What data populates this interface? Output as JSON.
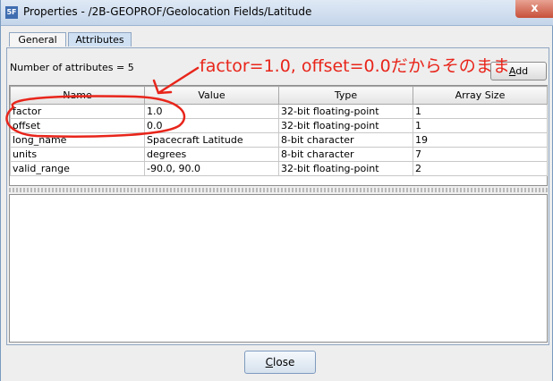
{
  "window": {
    "title": "Properties - /2B-GEOPROF/Geolocation Fields/Latitude",
    "app_icon_text": "5F",
    "close_glyph": "x"
  },
  "tabs": [
    {
      "label": "General"
    },
    {
      "label": "Attributes",
      "selected": true
    }
  ],
  "attributes": {
    "count_text": "Number of attributes = 5",
    "add_label": "Add",
    "columns": [
      "Name",
      "Value",
      "Type",
      "Array Size"
    ],
    "rows": [
      {
        "name": "factor",
        "value": "1.0",
        "type": "32-bit floating-point",
        "size": "1"
      },
      {
        "name": "offset",
        "value": "0.0",
        "type": "32-bit floating-point",
        "size": "1"
      },
      {
        "name": "long_name",
        "value": "Spacecraft Latitude",
        "type": "8-bit character",
        "size": "19"
      },
      {
        "name": "units",
        "value": "degrees",
        "type": "8-bit character",
        "size": "7"
      },
      {
        "name": "valid_range",
        "value": "-90.0, 90.0",
        "type": "32-bit floating-point",
        "size": "2"
      }
    ]
  },
  "annotation": {
    "text": "factor=1.0, offset=0.0だからそのまま",
    "color": "#e8251b"
  },
  "footer": {
    "close_label": "Close"
  },
  "icons": {
    "app": "hdf-view-icon",
    "close": "close-icon"
  }
}
